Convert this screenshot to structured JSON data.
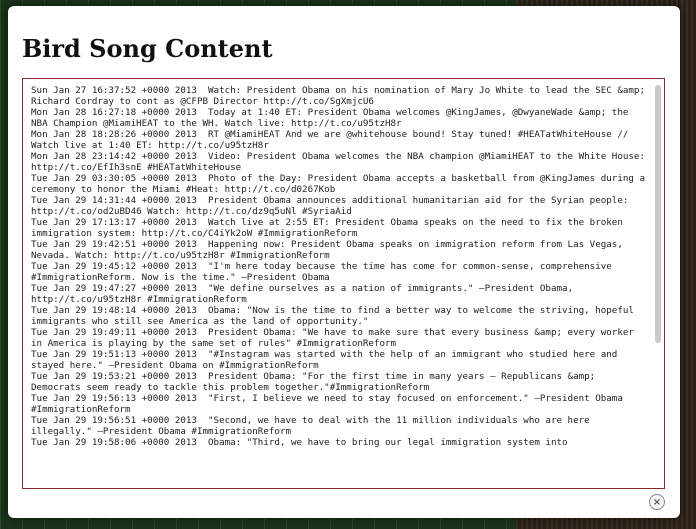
{
  "modal": {
    "title": "Bird Song Content",
    "content": "Sun Jan 27 16:37:52 +0000 2013  Watch: President Obama on his nomination of Mary Jo White to lead the SEC &amp; Richard Cordray to cont as @CFPB Director http://t.co/SgXmjcU6\nMon Jan 28 16:27:18 +0000 2013  Today at 1:40 ET: President Obama welcomes @KingJames, @DwyaneWade &amp; the NBA Champion @MiamiHEAT to the WH. Watch live: http://t.co/u95tzH8r\nMon Jan 28 18:28:26 +0000 2013  RT @MiamiHEAT And we are @whitehouse bound! Stay tuned! #HEATatWhiteHouse // Watch live at 1:40 ET: http://t.co/u95tzH8r\nMon Jan 28 23:14:42 +0000 2013  Video: President Obama welcomes the NBA champion @MiamiHEAT to the White House: http://t.co/EfIh3snE #HEATatWhiteHouse\nTue Jan 29 03:30:05 +0000 2013  Photo of the Day: President Obama accepts a basketball from @KingJames during a ceremony to honor the Miami #Heat: http://t.co/d0267Kob\nTue Jan 29 14:31:44 +0000 2013  President Obama announces additional humanitarian aid for the Syrian people: http://t.co/od2uBD46 Watch: http://t.co/dz9q5uNl #SyriaAid\nTue Jan 29 17:13:17 +0000 2013  Watch live at 2:55 ET: President Obama speaks on the need to fix the broken immigration system: http://t.co/C4iYk2oW #ImmigrationReform\nTue Jan 29 19:42:51 +0000 2013  Happening now: President Obama speaks on immigration reform from Las Vegas, Nevada. Watch: http://t.co/u95tzH8r #ImmigrationReform\nTue Jan 29 19:45:12 +0000 2013  \"I'm here today because the time has come for common-sense, comprehensive #ImmigrationReform. Now is the time.\" —President Obama\nTue Jan 29 19:47:27 +0000 2013  \"We define ourselves as a nation of immigrants.\" —President Obama, http://t.co/u95tzH8r #ImmigrationReform\nTue Jan 29 19:48:14 +0000 2013  Obama: \"Now is the time to find a better way to welcome the striving, hopeful immigrants who still see America as the land of opportunity.\"\nTue Jan 29 19:49:11 +0000 2013  President Obama: \"We have to make sure that every business &amp; every worker in America is playing by the same set of rules\" #ImmigrationReform\nTue Jan 29 19:51:13 +0000 2013  \"#Instagram was started with the help of an immigrant who studied here and stayed here.\" —President Obama on #ImmigrationReform\nTue Jan 29 19:53:21 +0000 2013  President Obama: \"For the first time in many years — Republicans &amp; Democrats seem ready to tackle this problem together.\"#ImmigrationReform\nTue Jan 29 19:56:13 +0000 2013  \"First, I believe we need to stay focused on enforcement.\" —President Obama #ImmigrationReform\nTue Jan 29 19:56:51 +0000 2013  \"Second, we have to deal with the 11 million individuals who are here illegally.\" —President Obama #ImmigrationReform\nTue Jan 29 19:58:06 +0000 2013  Obama: \"Third, we have to bring our legal immigration system into",
    "close_glyph": "×",
    "close_icon": "close-icon"
  },
  "colors": {
    "box_border": "#8b2a2a",
    "backdrop": "#1f3a1f"
  }
}
